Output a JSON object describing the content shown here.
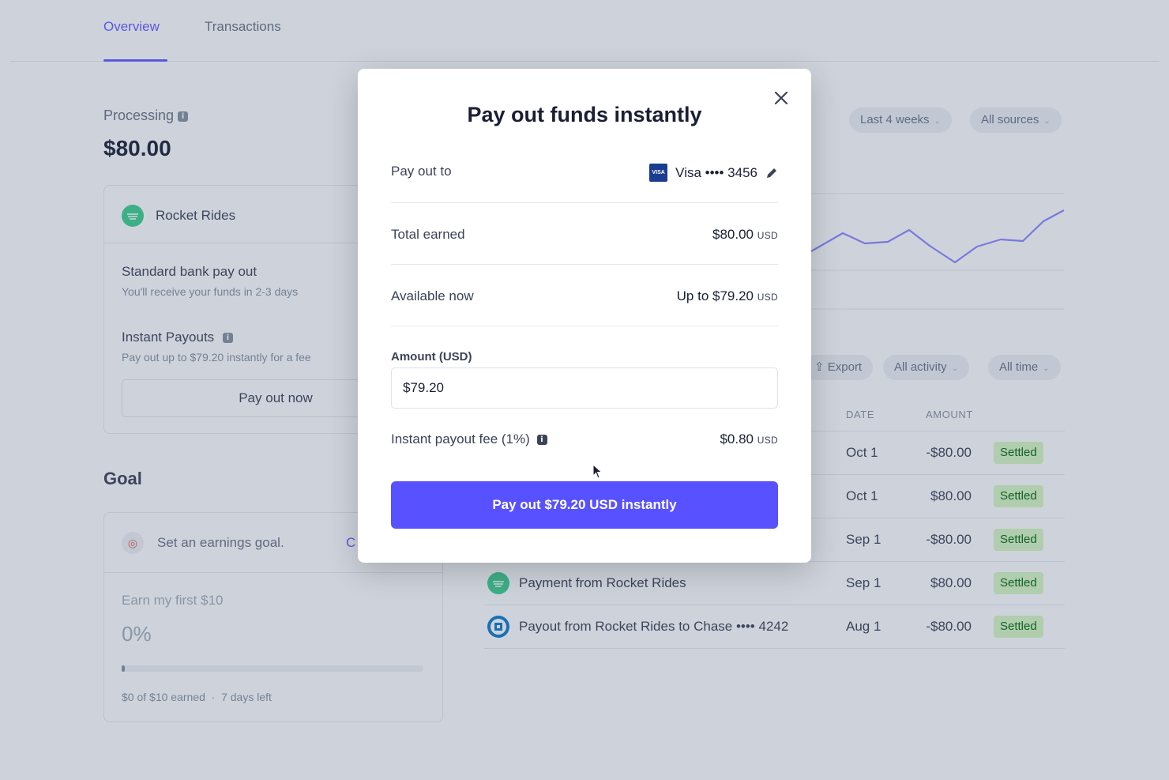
{
  "tabs": [
    "Overview",
    "Transactions"
  ],
  "processing": {
    "label": "Processing",
    "amount": "$80.00"
  },
  "payout_card": {
    "account_name": "Rocket Rides",
    "standard_title": "Standard bank pay out",
    "standard_sub": "You'll receive your funds in 2-3 days",
    "instant_title": "Instant Payouts",
    "instant_sub": "Pay out up to $79.20 instantly for a fee",
    "button": "Pay out now"
  },
  "goal": {
    "heading": "Goal",
    "prompt": "Set an earnings goal.",
    "prompt_link": "C",
    "target": "Earn my first $10",
    "percent": "0%",
    "progress": 0,
    "footer": "$0 of $10 earned  ·  7 days left"
  },
  "chart_filters": {
    "range": "Last 4 weeks",
    "sources": "All sources"
  },
  "activity_filters": {
    "export": "Export",
    "activity": "All activity",
    "time": "All time"
  },
  "table": {
    "headers": {
      "date": "DATE",
      "amount": "AMOUNT"
    },
    "rows": [
      {
        "description": "",
        "date": "Oct 1",
        "amount": "-$80.00",
        "status": "Settled",
        "icon": ""
      },
      {
        "description": "",
        "date": "Oct 1",
        "amount": "$80.00",
        "status": "Settled",
        "icon": ""
      },
      {
        "description": "",
        "date": "Sep 1",
        "amount": "-$80.00",
        "status": "Settled",
        "icon": ""
      },
      {
        "description": "Payment from Rocket Rides",
        "date": "Sep 1",
        "amount": "$80.00",
        "status": "Settled",
        "icon": "rocket-rides-logo-icon"
      },
      {
        "description": "Payout from Rocket Rides to Chase •••• 4242",
        "date": "Aug 1",
        "amount": "-$80.00",
        "status": "Settled",
        "icon": "chase-bank-logo-icon"
      }
    ]
  },
  "modal": {
    "title": "Pay out funds instantly",
    "pay_out_to_label": "Pay out to",
    "card_brand": "VISA",
    "card_text": "Visa •••• 3456",
    "total_earned_label": "Total earned",
    "total_earned_value": "$80.00",
    "available_label": "Available now",
    "available_value": "Up to $79.20",
    "currency": "USD",
    "amount_label": "Amount (USD)",
    "amount_value": "$79.20",
    "fee_label": "Instant payout fee (1%)",
    "fee_value": "$0.80",
    "submit": "Pay out $79.20 USD instantly"
  },
  "colors": {
    "accent": "#635bff",
    "button": "#5851ff",
    "settled_bg": "#d7f7c2",
    "settled_text": "#05690d",
    "rocket_green": "#3ecf8e",
    "chase_blue": "#117aca"
  }
}
